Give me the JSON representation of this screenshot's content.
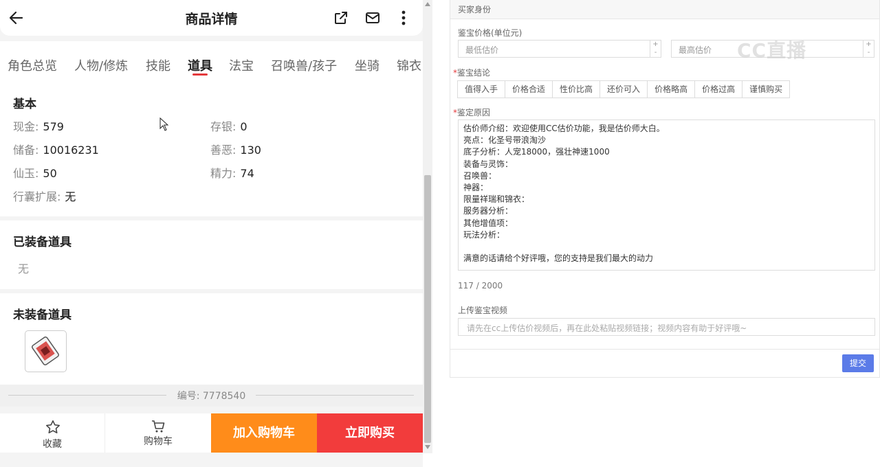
{
  "header": {
    "title": "商品详情"
  },
  "tabs": [
    {
      "label": "角色总览"
    },
    {
      "label": "人物/修炼"
    },
    {
      "label": "技能"
    },
    {
      "label": "道具",
      "active": true
    },
    {
      "label": "法宝"
    },
    {
      "label": "召唤兽/孩子"
    },
    {
      "label": "坐骑"
    },
    {
      "label": "锦衣"
    }
  ],
  "basic": {
    "title": "基本",
    "rows": [
      {
        "k": "现金:",
        "v": "579"
      },
      {
        "k": "存银:",
        "v": "0"
      },
      {
        "k": "储备:",
        "v": "10016231"
      },
      {
        "k": "善恶:",
        "v": "130"
      },
      {
        "k": "仙玉:",
        "v": "50"
      },
      {
        "k": "精力:",
        "v": "74"
      },
      {
        "k": "行囊扩展:",
        "v": "无"
      }
    ]
  },
  "equipped": {
    "title": "已装备道具",
    "empty": "无"
  },
  "unequipped": {
    "title": "未装备道具",
    "item_icon": "red-card-item-icon"
  },
  "code_line": "编号: 7778540",
  "bottom": {
    "favorite": "收藏",
    "cart": "购物车",
    "add_cart": "加入购物车",
    "buy_now": "立即购买"
  },
  "panel": {
    "section_title": "买家身份",
    "price_label": "鉴宝价格(单位元)",
    "min_placeholder": "最低估价",
    "max_placeholder": "最高估价",
    "conclusion_label": "鉴宝结论",
    "conclusions": [
      "值得入手",
      "价格合适",
      "性价比高",
      "还价可入",
      "价格略高",
      "价格过高",
      "谨慎购买"
    ],
    "reason_label": "鉴定原因",
    "reason_lines": [
      "估价师介绍：欢迎使用CC估价功能，我是估价师大白。",
      "亮点：化圣号带浪淘沙",
      "底子分析：人宠18000，强壮神速1000",
      "装备与灵饰：",
      "召唤兽：",
      "神器：",
      "限量祥瑞和锦衣：",
      "服务器分析：",
      "其他增值项：",
      "玩法分析：",
      "",
      "满意的话请给个好评哦，您的支持是我们最大的动力"
    ],
    "char_count": "117 / 2000",
    "video_label": "上传鉴宝视频",
    "video_placeholder": "请先在cc上传估价视频后，再在此处粘贴视频链接；视频内容有助于好评哦~",
    "submit_label": "提交"
  },
  "watermark": "CC直播"
}
